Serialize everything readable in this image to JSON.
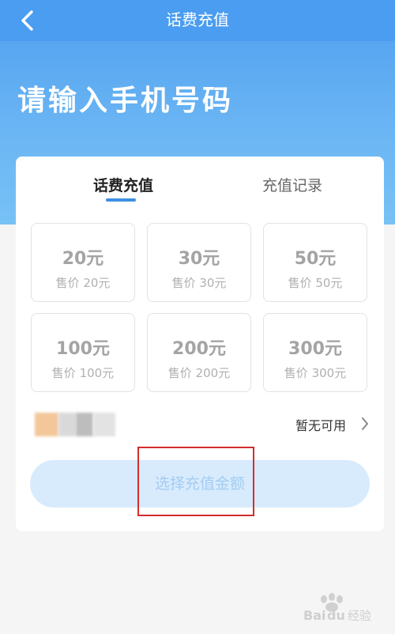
{
  "nav": {
    "title": "话费充值"
  },
  "hero": {
    "title": "请输入手机号码"
  },
  "tabs": [
    {
      "label": "话费充值",
      "active": true
    },
    {
      "label": "充值记录",
      "active": false
    }
  ],
  "amounts": [
    {
      "amount": "20元",
      "price": "售价 20元"
    },
    {
      "amount": "30元",
      "price": "售价 30元"
    },
    {
      "amount": "50元",
      "price": "售价 50元"
    },
    {
      "amount": "100元",
      "price": "售价 100元"
    },
    {
      "amount": "200元",
      "price": "售价 200元"
    },
    {
      "amount": "300元",
      "price": "售价 300元"
    }
  ],
  "coupon": {
    "status": "暂无可用"
  },
  "submit": {
    "label": "选择充值金额"
  },
  "colors": {
    "header": "#4a9df0",
    "accent": "#3f8fe0",
    "highlight": "#d32d2d"
  }
}
